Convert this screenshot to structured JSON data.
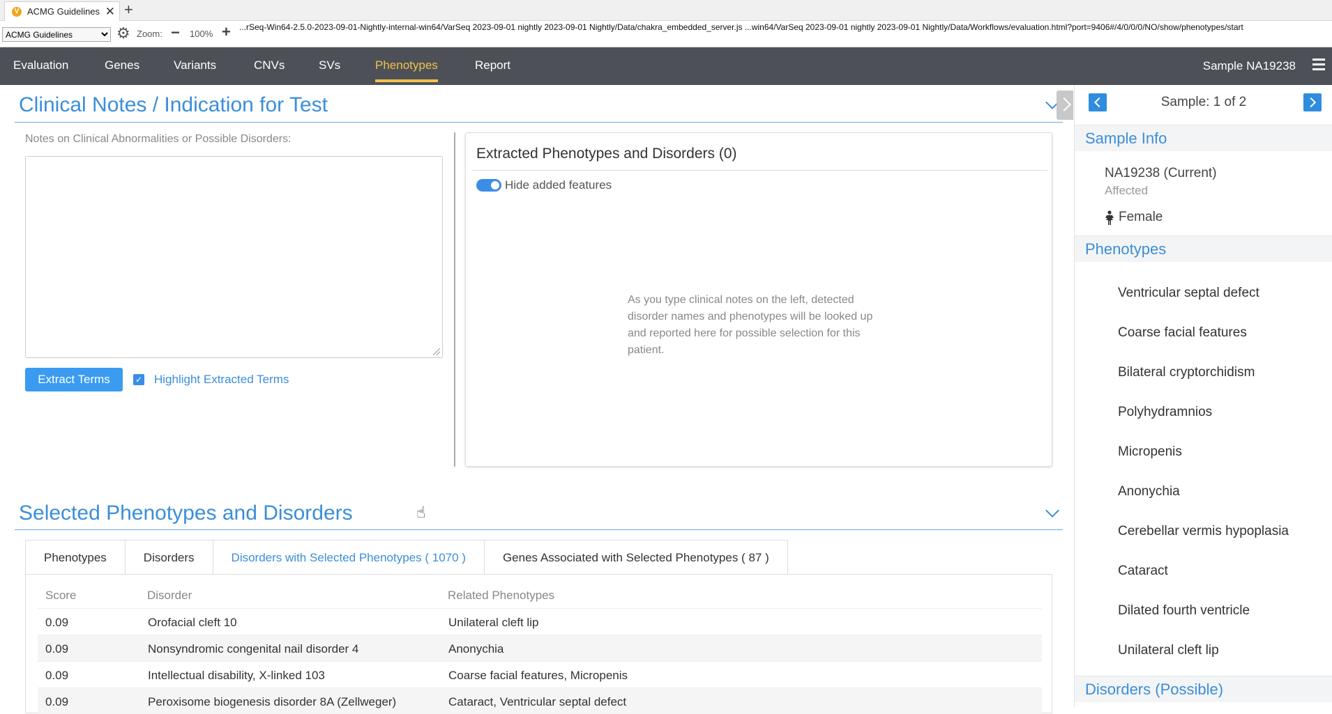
{
  "browser": {
    "tab_title": "ACMG Guidelines",
    "favicon": "V",
    "selector_value": "ACMG Guidelines",
    "zoom_label": "Zoom:",
    "zoom_value": "100%",
    "url": "...rSeq-Win64-2.5.0-2023-09-01-Nightly-internal-win64/VarSeq 2023-09-01 nightly 2023-09-01 Nightly/Data/chakra_embedded_server.js ...win64/VarSeq 2023-09-01 nightly 2023-09-01 Nightly/Data/Workflows/evaluation.html?port=9406#/4/0/0/0/NO/show/phenotypes/start"
  },
  "nav": {
    "items": [
      {
        "label": "Evaluation"
      },
      {
        "label": "Genes"
      },
      {
        "label": "Variants"
      },
      {
        "label": "CNVs"
      },
      {
        "label": "SVs"
      },
      {
        "label": "Phenotypes"
      },
      {
        "label": "Report"
      }
    ],
    "active_index": 5,
    "sample_label": "Sample NA19238"
  },
  "clinical": {
    "title": "Clinical Notes / Indication for Test",
    "notes_label": "Notes on Clinical Abnormalities or Possible Disorders:",
    "notes_value": "",
    "extract_button": "Extract Terms",
    "highlight_label": "Highlight Extracted Terms",
    "highlight_checked": true
  },
  "extracted": {
    "title": "Extracted Phenotypes and Disorders (0)",
    "toggle_label": "Hide added features",
    "toggle_on": true,
    "hint": "As you type clinical notes on the left, detected disorder names and phenotypes will be looked up and reported here for possible selection for this patient."
  },
  "selected": {
    "title": "Selected Phenotypes and Disorders",
    "tabs": [
      {
        "label": "Phenotypes"
      },
      {
        "label": "Disorders"
      },
      {
        "label": "Disorders with Selected Phenotypes ( 1070 )"
      },
      {
        "label": "Genes Associated with Selected Phenotypes ( 87 )"
      }
    ],
    "active_tab": 2,
    "columns": {
      "score": "Score",
      "disorder": "Disorder",
      "related": "Related Phenotypes"
    },
    "rows": [
      {
        "score": "0.09",
        "disorder": "Orofacial cleft 10",
        "related": "Unilateral cleft lip"
      },
      {
        "score": "0.09",
        "disorder": "Nonsyndromic congenital nail disorder 4",
        "related": "Anonychia"
      },
      {
        "score": "0.09",
        "disorder": "Intellectual disability, X-linked 103",
        "related": "Coarse facial features, Micropenis"
      },
      {
        "score": "0.09",
        "disorder": "Peroxisome biogenesis disorder 8A (Zellweger)",
        "related": "Cataract, Ventricular septal defect"
      }
    ]
  },
  "sidebar": {
    "counter": "Sample: 1 of 2",
    "sample_info_title": "Sample Info",
    "sample_name": "NA19238 (Current)",
    "sample_status": "Affected",
    "sex": "Female",
    "phenotypes_title": "Phenotypes",
    "phenotypes": [
      "Ventricular septal defect",
      "Coarse facial features",
      "Bilateral cryptorchidism",
      "Polyhydramnios",
      "Micropenis",
      "Anonychia",
      "Cerebellar vermis hypoplasia",
      "Cataract",
      "Dilated fourth ventricle",
      "Unilateral cleft lip"
    ],
    "disorders_title": "Disorders (Possible)"
  },
  "colors": {
    "accent": "#3b8ed8",
    "nav_bg": "#4d5157",
    "nav_active": "#f0c24c",
    "button": "#3a9bf0"
  }
}
